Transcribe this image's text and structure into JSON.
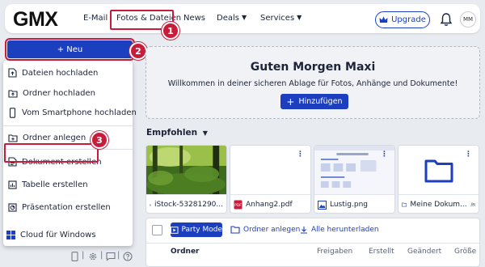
{
  "header": {
    "logo": "GMX",
    "nav": [
      {
        "label": "E-Mail"
      },
      {
        "label": "Fotos & Dateien"
      },
      {
        "label": "News"
      },
      {
        "label": "Deals"
      },
      {
        "label": "Services"
      }
    ],
    "upgrade_label": "Upgrade",
    "avatar_initials": "MM"
  },
  "callouts": [
    "1",
    "2",
    "3"
  ],
  "sidebar": {
    "new_label": "+ Neu",
    "menu": [
      {
        "label": "Dateien hochladen",
        "icon": "file-upload-icon"
      },
      {
        "label": "Ordner hochladen",
        "icon": "folder-upload-icon"
      },
      {
        "label": "Vom Smartphone hochladen",
        "icon": "smartphone-icon"
      },
      {
        "label": "Ordner anlegen",
        "icon": "folder-add-icon"
      },
      {
        "label": "Dokument erstellen",
        "icon": "document-icon"
      },
      {
        "label": "Tabelle erstellen",
        "icon": "spreadsheet-icon"
      },
      {
        "label": "Präsentation erstellen",
        "icon": "presentation-icon"
      }
    ],
    "cloud_label": "Cloud für Windows"
  },
  "main": {
    "greeting": "Guten Morgen Maxi",
    "subtitle": "Willkommen in deiner sicheren Ablage für Fotos, Anhänge und Dokumente!",
    "add_label": "Hinzufügen",
    "recommended_label": "Empfohlen",
    "cards": [
      {
        "name": "iStock-53281290...",
        "type": "image"
      },
      {
        "name": "Anhang2.pdf",
        "type": "pdf"
      },
      {
        "name": "Lustig.png",
        "type": "image"
      },
      {
        "name": "Meine Dokum...",
        "type": "folder"
      }
    ],
    "toolbar": {
      "party_mode": "Party Mode",
      "create_folder": "Ordner anlegen",
      "download_all": "Alle herunterladen"
    },
    "columns": [
      "Ordner",
      "Freigaben",
      "Erstellt",
      "Geändert",
      "Größe"
    ]
  },
  "colors": {
    "accent": "#1c3fbf",
    "highlight": "#c81d3a",
    "background": "#e8ebf0"
  }
}
